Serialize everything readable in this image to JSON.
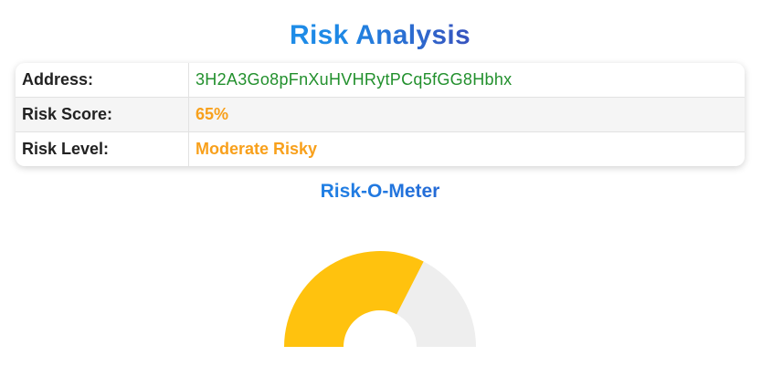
{
  "title": "Risk Analysis",
  "rows": [
    {
      "label": "Address:",
      "value": "3H2A3Go8pFnXuHVHRytPCq5fGG8Hbhx"
    },
    {
      "label": "Risk Score:",
      "value": "65%"
    },
    {
      "label": "Risk Level:",
      "value": "Moderate Risky"
    }
  ],
  "meter": {
    "title": "Risk-O-Meter",
    "score_fraction": 0.65,
    "fill_color": "#ffc20e",
    "track_color": "#eeeeee"
  },
  "colors": {
    "address": "#22902d",
    "accent": "#f8a01b"
  }
}
